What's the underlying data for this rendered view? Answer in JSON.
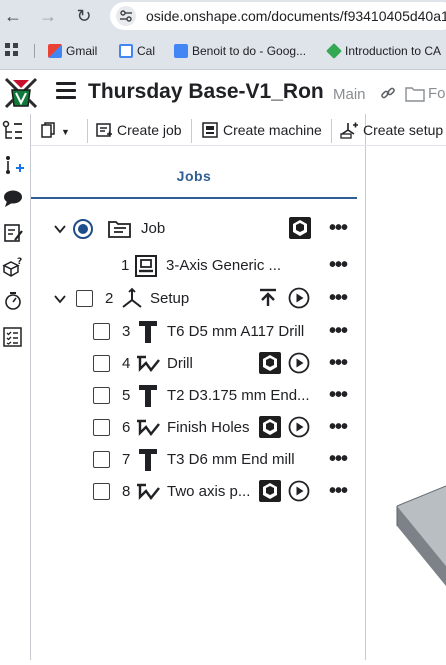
{
  "browser": {
    "url": "oside.onshape.com/documents/f93410405d40a1",
    "bookmarks": [
      {
        "label": "Gmail",
        "icon": "gmail-icon"
      },
      {
        "label": "Cal",
        "icon": "calendar-icon"
      },
      {
        "label": "Benoit to do - Goog...",
        "icon": "google-docs-icon"
      },
      {
        "label": "Introduction to CA",
        "icon": "course-icon"
      }
    ]
  },
  "header": {
    "title": "Thursday Base-V1_Ron",
    "branch": "Main",
    "folder_label": "Fo"
  },
  "toolbar": {
    "create_job": "Create job",
    "create_machine": "Create machine",
    "create_setup": "Create setup"
  },
  "panel": {
    "tab": "Jobs",
    "rows": [
      {
        "num": "",
        "label": "Job",
        "icon": "job-icon"
      },
      {
        "num": "1",
        "label": "3-Axis Generic ...",
        "icon": "machine-icon"
      },
      {
        "num": "2",
        "label": "Setup",
        "icon": "setup-axes-icon"
      },
      {
        "num": "3",
        "label": "T6 D5 mm A117 Drill",
        "icon": "tool-icon"
      },
      {
        "num": "4",
        "label": "Drill",
        "icon": "toolpath-icon"
      },
      {
        "num": "5",
        "label": "T2 D3.175 mm End...",
        "icon": "tool-icon"
      },
      {
        "num": "6",
        "label": "Finish Holes",
        "icon": "toolpath-icon"
      },
      {
        "num": "7",
        "label": "T3 D6 mm End mill",
        "icon": "tool-icon"
      },
      {
        "num": "8",
        "label": "Two axis p...",
        "icon": "toolpath-icon"
      }
    ],
    "more": "•••"
  },
  "colors": {
    "accent": "#2f5f94",
    "chrome": "#dfe3ea"
  }
}
